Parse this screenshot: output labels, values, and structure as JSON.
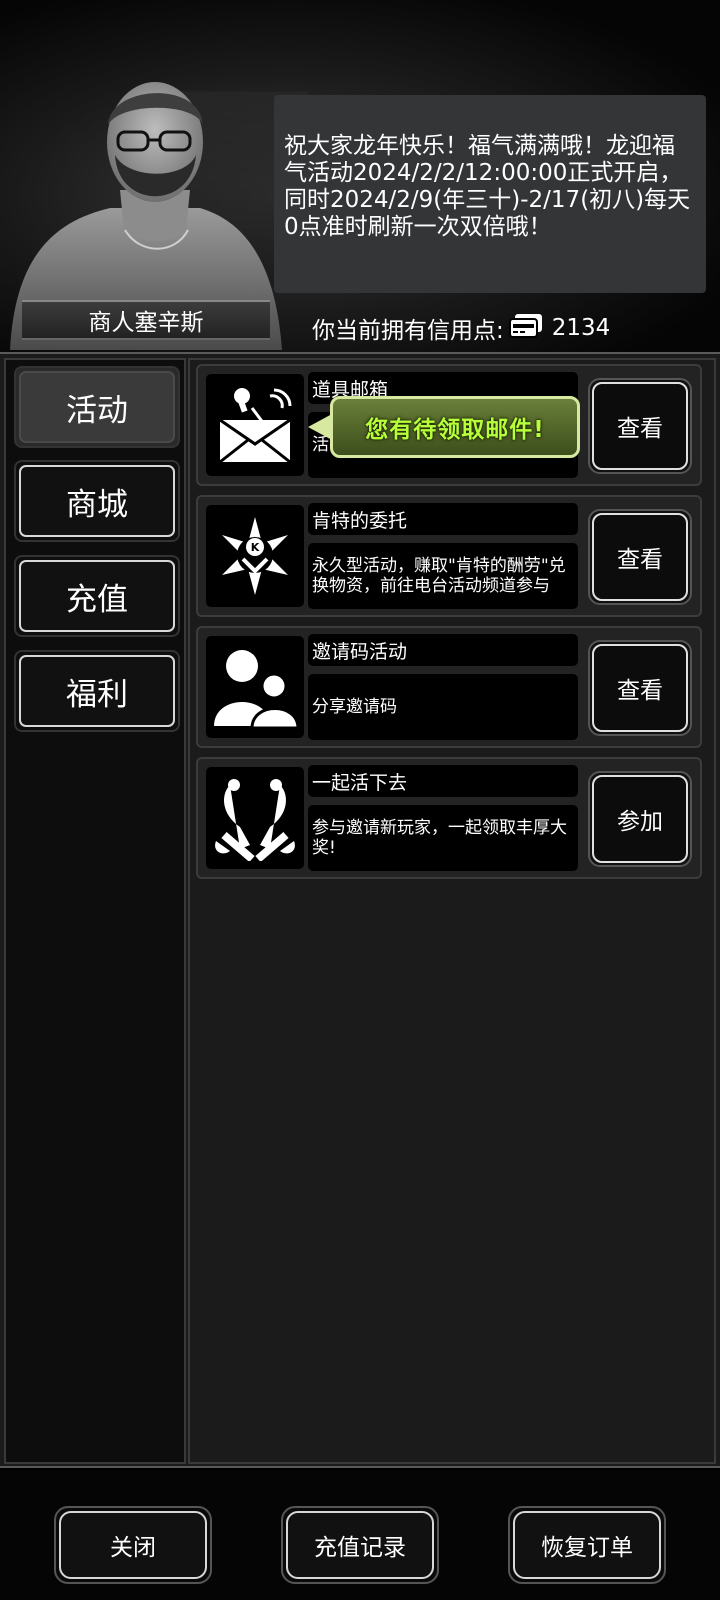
{
  "merchant": {
    "name": "商人塞辛斯"
  },
  "notice": {
    "text": "祝大家龙年快乐！福气满满哦！龙迎福气活动2024/2/2/12:00:00正式开启，同时2024/2/9(年三十)-2/17(初八)每天0点准时刷新一次双倍哦！"
  },
  "credits": {
    "label": "你当前拥有信用点:",
    "value": "2134",
    "icon": "credit-card-icon"
  },
  "tabs": [
    {
      "label": "活动",
      "active": true
    },
    {
      "label": "商城",
      "active": false
    },
    {
      "label": "充值",
      "active": false
    },
    {
      "label": "福利",
      "active": false
    }
  ],
  "activities": [
    {
      "title": "道具邮箱",
      "desc": "活",
      "button": "查看",
      "icon": "mailbox-icon",
      "tooltip": "您有待领取邮件!"
    },
    {
      "title": "肯特的委托",
      "desc": "永久型活动，赚取\"肯特的酬劳\"兑换物资，前往电台活动频道参与",
      "button": "查看",
      "icon": "kent-emblem-icon"
    },
    {
      "title": "邀请码活动",
      "desc": "分享邀请码",
      "button": "查看",
      "icon": "people-icon"
    },
    {
      "title": "一起活下去",
      "desc": "参与邀请新玩家，一起领取丰厚大奖!",
      "button": "参加",
      "icon": "birds-emblem-icon"
    }
  ],
  "footer": {
    "close": "关闭",
    "recharge_history": "充值记录",
    "restore_order": "恢复订单"
  },
  "colors": {
    "tooltip_text": "#b6ff3a",
    "tooltip_bg": "#4b5f25"
  }
}
